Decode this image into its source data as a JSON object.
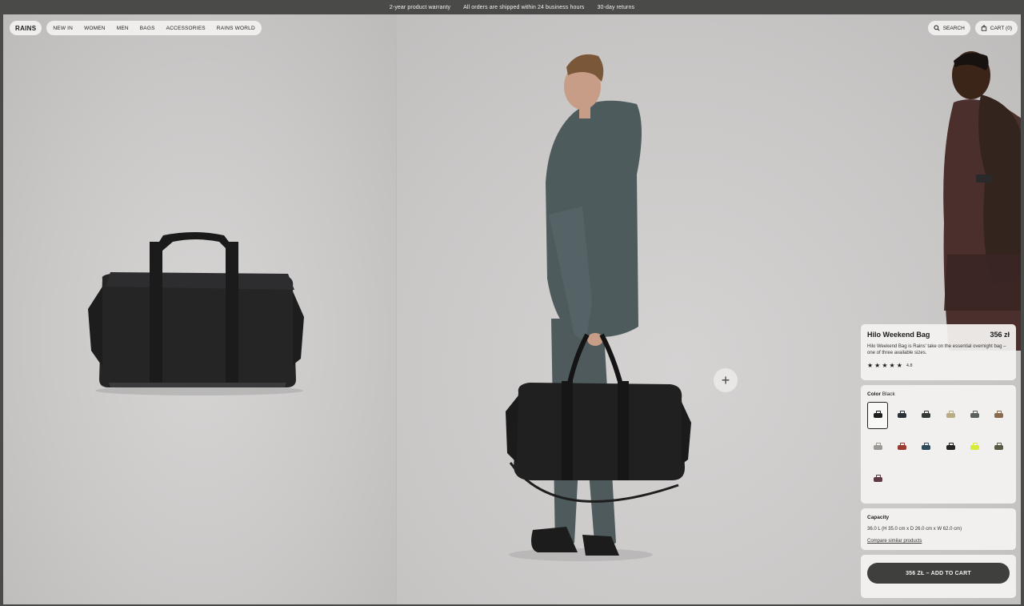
{
  "announcement": [
    "2-year product warranty",
    "All orders are shipped within 24 business hours",
    "30-day returns"
  ],
  "nav": {
    "logo": "RAINS",
    "links": [
      "NEW IN",
      "WOMEN",
      "MEN",
      "BAGS",
      "ACCESSORIES",
      "RAINS WORLD"
    ],
    "search": "SEARCH",
    "cart": "CART (0)"
  },
  "product": {
    "name": "Hilo Weekend Bag",
    "price": "356 zł",
    "description": "Hilo Weekend Bag is Rains' take on the essential overnight bag – one of three available sizes.",
    "rating": "4.8",
    "stars": 5
  },
  "color": {
    "label": "Color",
    "selected": "Black",
    "swatches": [
      "#1f1f1f",
      "#2b3038",
      "#353a36",
      "#b8ac86",
      "#59605e",
      "#8a6a4c",
      "#9c9893",
      "#9b3a2e",
      "#2f4a5a",
      "#242424",
      "#d8ea3a",
      "#5a5a44",
      "#5d3a44"
    ]
  },
  "capacity": {
    "title": "Capacity",
    "dims": "36.0 L (H 35.0 cm x D 26.0 cm x W 62.0 cm)",
    "compare": "Compare similar products"
  },
  "cta": {
    "add_to_cart": "356 ZŁ – ADD TO CART"
  },
  "icons": {
    "search": "search-icon",
    "cart": "bag-icon",
    "plus": "plus-icon",
    "star": "star-icon"
  }
}
